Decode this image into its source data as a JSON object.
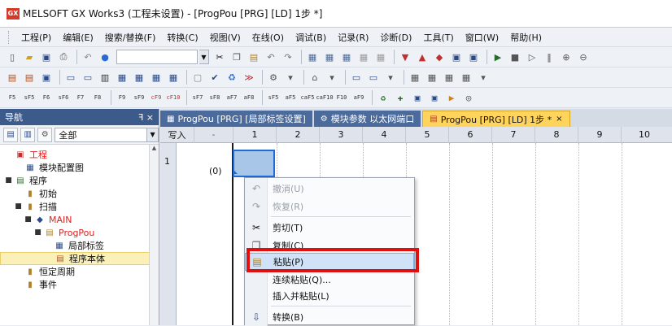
{
  "window": {
    "logo_text": "GX",
    "title": "MELSOFT GX Works3 (工程未设置) - [ProgPou [PRG] [LD] 1步 *]"
  },
  "menubar": {
    "items": [
      "工程(P)",
      "编辑(E)",
      "搜索/替换(F)",
      "转换(C)",
      "视图(V)",
      "在线(O)",
      "调试(B)",
      "记录(R)",
      "诊断(D)",
      "工具(T)",
      "窗口(W)",
      "帮助(H)"
    ]
  },
  "toolbar3": {
    "key_labels": [
      "F5",
      "sF5",
      "F6",
      "sF6",
      "F7",
      "F8",
      "F9",
      "sF9",
      "cF9",
      "cF10",
      "sF7",
      "sF8",
      "aF7",
      "aF8",
      "sF5",
      "aF5",
      "caF5",
      "caF10",
      "F10",
      "aF9"
    ]
  },
  "navigation": {
    "title": "导航",
    "pin_label": "ꟻ ×",
    "filter_value": "全部",
    "tree": [
      {
        "label": "工程",
        "level": 0,
        "expander": "",
        "icon": "project-icon",
        "red": true,
        "selected": false
      },
      {
        "label": "模块配置图",
        "level": 1,
        "expander": "",
        "icon": "module-config-icon",
        "red": false,
        "selected": false
      },
      {
        "label": "程序",
        "level": 0,
        "expander": "■",
        "icon": "program-folder-icon",
        "red": false,
        "selected": false
      },
      {
        "label": "初始",
        "level": 1,
        "expander": "",
        "icon": "folder-icon",
        "red": false,
        "selected": false
      },
      {
        "label": "扫描",
        "level": 1,
        "expander": "■",
        "icon": "folder-icon",
        "red": false,
        "selected": false
      },
      {
        "label": "MAIN",
        "level": 2,
        "expander": "■",
        "icon": "task-icon",
        "red": true,
        "selected": false
      },
      {
        "label": "ProgPou",
        "level": 3,
        "expander": "■",
        "icon": "program-icon",
        "red": true,
        "selected": false
      },
      {
        "label": "局部标签",
        "level": 4,
        "expander": "",
        "icon": "label-icon",
        "red": false,
        "selected": false
      },
      {
        "label": "程序本体",
        "level": 4,
        "expander": "",
        "icon": "program-body-icon",
        "red": false,
        "selected": true
      },
      {
        "label": "恒定周期",
        "level": 1,
        "expander": "",
        "icon": "folder-icon",
        "red": false,
        "selected": false
      },
      {
        "label": "事件",
        "level": 1,
        "expander": "",
        "icon": "folder-icon",
        "red": false,
        "selected": false
      }
    ]
  },
  "tabs": [
    {
      "label": "ProgPou [PRG] [局部标签设置]",
      "active": false,
      "closable": false
    },
    {
      "label": "模块参数 以太网端口",
      "active": false,
      "closable": false
    },
    {
      "label": "ProgPou [PRG] [LD] 1步 *",
      "active": true,
      "closable": true
    }
  ],
  "editor": {
    "mode_label": "写入",
    "mode_dropdown": "-",
    "columns": [
      "1",
      "2",
      "3",
      "4",
      "5",
      "6",
      "7",
      "8",
      "9",
      "10"
    ],
    "row_number": "1",
    "step_number": "(0)"
  },
  "context_menu": {
    "items": [
      {
        "label": "撤消(U)",
        "icon": "undo-icon",
        "glyph": "↶",
        "disabled": true,
        "highlighted": false
      },
      {
        "label": "恢复(R)",
        "icon": "redo-icon",
        "glyph": "↷",
        "disabled": true,
        "highlighted": false
      },
      {
        "label": "剪切(T)",
        "icon": "cut-icon",
        "glyph": "✂",
        "disabled": false,
        "highlighted": false
      },
      {
        "label": "复制(C)",
        "icon": "copy-icon",
        "glyph": "❐",
        "disabled": false,
        "highlighted": false
      },
      {
        "label": "粘贴(P)",
        "icon": "paste-icon",
        "glyph": "📋",
        "disabled": false,
        "highlighted": true
      },
      {
        "label": "连续粘贴(Q)...",
        "icon": "",
        "glyph": "",
        "disabled": false,
        "highlighted": false
      },
      {
        "label": "插入并粘贴(L)",
        "icon": "",
        "glyph": "",
        "disabled": false,
        "highlighted": false
      },
      {
        "label": "转换(B)",
        "icon": "convert-icon",
        "glyph": "⇩",
        "disabled": false,
        "highlighted": false
      }
    ]
  },
  "colors": {
    "highlight_box": "#e01010",
    "active_tab": "#ffd45c",
    "nav_header": "#3c5a8a",
    "selected_cell": "#a8c6e8"
  }
}
